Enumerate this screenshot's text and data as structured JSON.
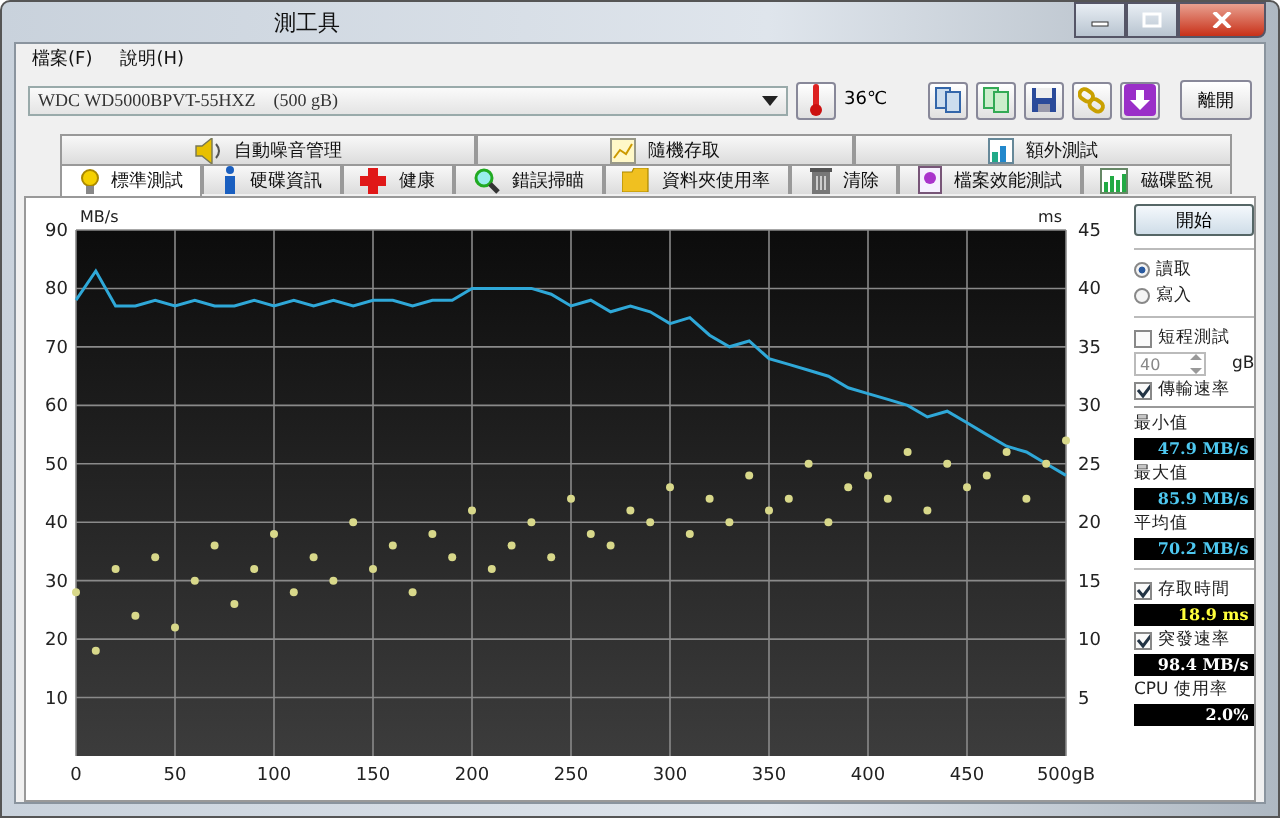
{
  "window": {
    "title": "測工具"
  },
  "menu": [
    "檔案(F)",
    "說明(H)"
  ],
  "toolbar": {
    "drive": "WDC WD5000BPVT-55HXZ    (500 gB)",
    "temperature": "36℃",
    "exit_button": "離開"
  },
  "tabs_top": [
    {
      "label": "自動噪音管理",
      "selected": false
    },
    {
      "label": "隨機存取",
      "selected": false
    },
    {
      "label": "額外測試",
      "selected": false
    }
  ],
  "tabs": [
    {
      "label": "標準測試",
      "selected": true
    },
    {
      "label": "硬碟資訊",
      "selected": false
    },
    {
      "label": "健康",
      "selected": false
    },
    {
      "label": "錯誤掃瞄",
      "selected": false
    },
    {
      "label": "資料夾使用率",
      "selected": false
    },
    {
      "label": "清除",
      "selected": false
    },
    {
      "label": "檔案效能測試",
      "selected": false
    },
    {
      "label": "磁碟監視",
      "selected": false
    }
  ],
  "transfer_graph": {
    "chart_data": {
      "type": "line",
      "grid": true,
      "ylabel": "MB/s",
      "xlim": [
        0,
        500
      ],
      "ylim": [
        0,
        90
      ],
      "x": [
        0,
        10,
        20,
        30,
        40,
        50,
        60,
        70,
        80,
        90,
        100,
        110,
        120,
        130,
        140,
        150,
        160,
        170,
        180,
        190,
        200,
        210,
        220,
        230,
        240,
        250,
        260,
        270,
        280,
        290,
        300,
        310,
        320,
        330,
        340,
        350,
        360,
        370,
        380,
        390,
        400,
        410,
        420,
        430,
        440,
        450,
        460,
        470,
        480,
        490,
        500
      ],
      "xticks": [
        0,
        50,
        100,
        150,
        200,
        250,
        300,
        350,
        400,
        450,
        {
          "value": 500,
          "label": "500gB"
        }
      ],
      "yticks": [
        10,
        20,
        30,
        40,
        50,
        60,
        70,
        80,
        90
      ],
      "series": [
        {
          "color": "#2fa8d8",
          "values": [
            78,
            83,
            77,
            77,
            78,
            77,
            78,
            77,
            77,
            78,
            77,
            78,
            77,
            78,
            77,
            78,
            78,
            77,
            78,
            78,
            80,
            80,
            80,
            80,
            79,
            77,
            78,
            76,
            77,
            76,
            74,
            75,
            72,
            70,
            71,
            68,
            67,
            66,
            65,
            63,
            62,
            61,
            60,
            58,
            59,
            57,
            55,
            53,
            52,
            50,
            48
          ]
        }
      ]
    }
  },
  "access_graph": {
    "chart_data": {
      "type": "scatter",
      "ylabel": "ms",
      "xlim": [
        0,
        500
      ],
      "ylim": [
        0,
        45
      ],
      "x": [
        0,
        10,
        20,
        30,
        40,
        50,
        60,
        70,
        80,
        90,
        100,
        110,
        120,
        130,
        140,
        150,
        160,
        170,
        180,
        190,
        200,
        210,
        220,
        230,
        240,
        250,
        260,
        270,
        280,
        290,
        300,
        310,
        320,
        330,
        340,
        350,
        360,
        370,
        380,
        390,
        400,
        410,
        420,
        430,
        440,
        450,
        460,
        470,
        480,
        490,
        500
      ],
      "yticks": [
        5,
        10,
        15,
        20,
        25,
        30,
        35,
        40,
        45
      ],
      "series": [
        {
          "color": "#d8d88a",
          "values": [
            14,
            9,
            16,
            12,
            17,
            11,
            15,
            18,
            13,
            16,
            19,
            14,
            17,
            15,
            20,
            16,
            18,
            14,
            19,
            17,
            21,
            16,
            18,
            20,
            17,
            22,
            19,
            18,
            21,
            20,
            23,
            19,
            22,
            20,
            24,
            21,
            22,
            25,
            20,
            23,
            24,
            22,
            26,
            21,
            25,
            23,
            24,
            26,
            22,
            25,
            27
          ]
        }
      ]
    }
  },
  "side": {
    "start_button": "開始",
    "modes": [
      {
        "label": "讀取",
        "selected": true
      },
      {
        "label": "寫入",
        "selected": false
      }
    ],
    "short_test": {
      "label": "短程測試",
      "checked": false
    },
    "short_size": {
      "value": "40",
      "unit": "gB"
    },
    "transfer": {
      "label": "傳輸速率",
      "checked": true
    },
    "stats": [
      {
        "label": "最小值",
        "value": "47.9 MB/s"
      },
      {
        "label": "最大值",
        "value": "85.9 MB/s"
      },
      {
        "label": "平均值",
        "value": "70.2 MB/s"
      }
    ],
    "access": {
      "label": "存取時間",
      "checked": true,
      "value": "18.9 ms"
    },
    "burst": {
      "label": "突發速率",
      "checked": true,
      "value": "98.4 MB/s"
    },
    "cpu": {
      "label": "CPU 使用率",
      "value": "2.0%"
    }
  }
}
